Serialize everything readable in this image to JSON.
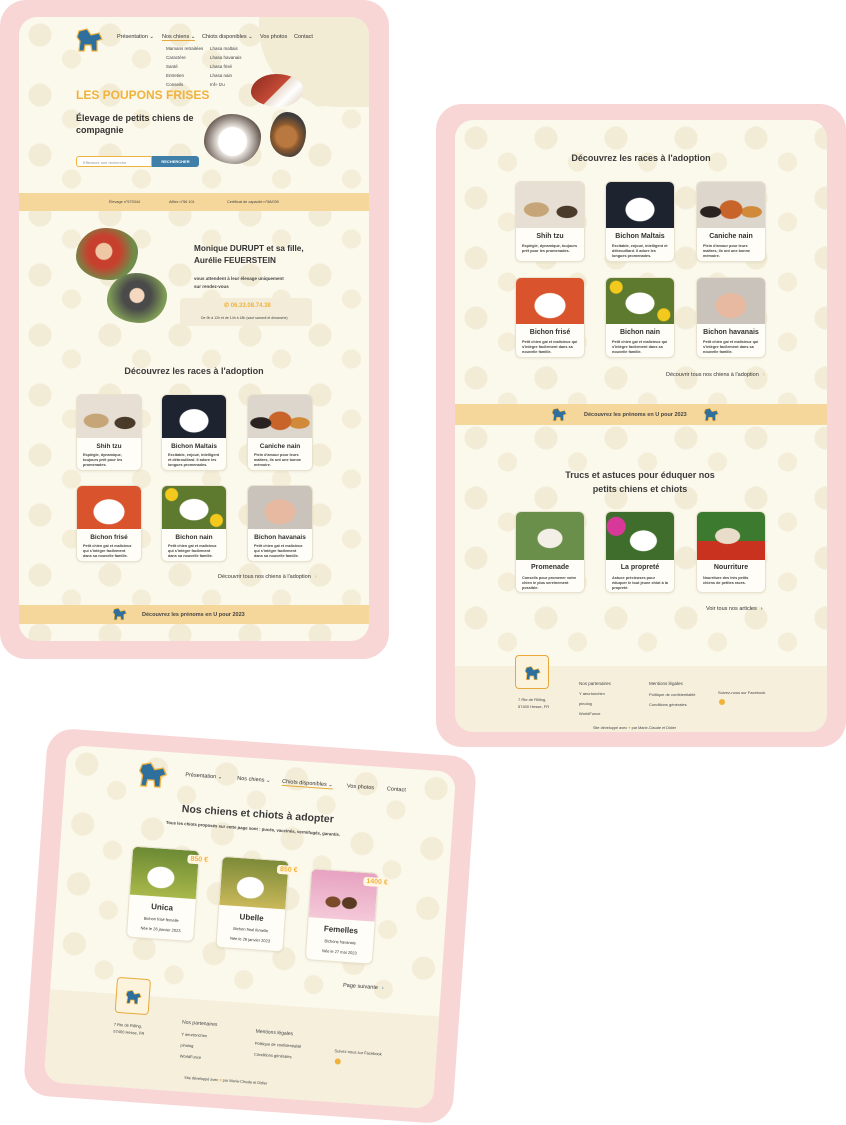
{
  "colors": {
    "frame": "#f8d6d6",
    "page": "#fbf8ec",
    "accent": "#f0b23c",
    "band": "#f6d79b",
    "dog": "#2e6f9e"
  },
  "site": {
    "nav": {
      "presentation": "Présentation",
      "nos_chiens": "Nos chiens",
      "chiots": "Chiots disponibles",
      "photos": "Vos photos",
      "contact": "Contact"
    },
    "submenu_chiens": [
      "Mamans retraitées",
      "Caractère",
      "Santé",
      "Entretien",
      "Conseils"
    ],
    "submenu_chiots": [
      "Lhasa maltais",
      "Lhasa havanais",
      "Lhasa frisé",
      "Lhasa nain",
      "Inf» tzu"
    ],
    "hero_title": "LES POUPONS FRISES",
    "hero_subtitle": "Élevage de petits chiens de compagnie",
    "search_placeholder": "Effectuez une recherche",
    "search_button": "RECHERCHER",
    "band_items": [
      "Élevage n°575344",
      "Affixe n°56 101",
      "Certificat de capacité n°58/039"
    ],
    "owner_title": "Monique DURUPT et sa fille, Aurélie FEUERSTEIN",
    "owner_text": "vous attendent à leur élevage uniquement sur rendez-vous",
    "phone": "06.33.08.74.38",
    "hours": "De 9h à 12h et de 14h à 18h (sauf samedi et dimanche)",
    "breeds_title": "Découvrez les races à l'adoption",
    "breeds": [
      {
        "name": "Shih tzu",
        "desc": "Espiègle, dynamique, toujours prêt pour les promenades."
      },
      {
        "name": "Bichon Maltais",
        "desc": "Excitable, enjoué, intelligent et débrouillard. Il adore les longues promenades."
      },
      {
        "name": "Caniche nain",
        "desc": "Plein d'amour pour leurs maîtres, ils ont une bonne mémoire."
      },
      {
        "name": "Bichon frisé",
        "desc": "Petit chien gai et malicieux qui s'intègre facilement dans sa nouvelle famille."
      },
      {
        "name": "Bichon nain",
        "desc": "Petit chien gai et malicieux qui s'intègre facilement dans sa nouvelle famille."
      },
      {
        "name": "Bichon havanais",
        "desc": "Petit chien gai et malicieux qui s'intègre facilement dans sa nouvelle famille."
      }
    ],
    "breeds_link": "Découvrir tous nos chiens à l'adoption",
    "names_band": "Découvrez les prénoms en U pour 2023",
    "tips_title": "Trucs et astuces pour éduquer nos petits chiens et chiots",
    "tips": [
      {
        "name": "Promenade",
        "desc": "Conseils pour promener votre chien le plus sereinement possible."
      },
      {
        "name": "La propreté",
        "desc": "Astuce précieuses pour éduquer le tout jeune chiot à la propreté."
      },
      {
        "name": "Nourriture",
        "desc": "Nourriture des très petits chiens de petites races."
      }
    ],
    "tips_link": "Voir tous nos articles",
    "footer": {
      "address_1": "7 Rte de Rilling,",
      "address_2": "57400 Hesse, FR",
      "partners_title": "Nos partenaires",
      "partners": [
        "Y aeurtonchim",
        "pinolog",
        "WorldFunce"
      ],
      "legal_title": "Mentions légales",
      "legal": [
        "Politique de confidentialité",
        "Conditions générales"
      ],
      "social": "Suivez-nous sur Facebook",
      "credit": "Site développé avec",
      "credit_by": "par Marie-Claude et Didier"
    },
    "adopt": {
      "title": "Nos chiens et chiots à adopter",
      "subtitle": "Tous les chiots proposés sur cette page sont : pucés, vaccinés, vermifugés, garantis.",
      "puppies": [
        {
          "name": "Unica",
          "breed": "Bichon frisé femelle",
          "date": "Née le 26 janvier 2023",
          "price": "850 €"
        },
        {
          "name": "Ubelle",
          "breed": "Bichon frisé femelle",
          "date": "Née le 26 janvier 2023",
          "price": "850 €"
        },
        {
          "name": "Femelles",
          "breed": "Bichons havanais",
          "date": "Née le 27 mai 2023",
          "price": "1400 €"
        }
      ],
      "next": "Page suivante"
    }
  }
}
